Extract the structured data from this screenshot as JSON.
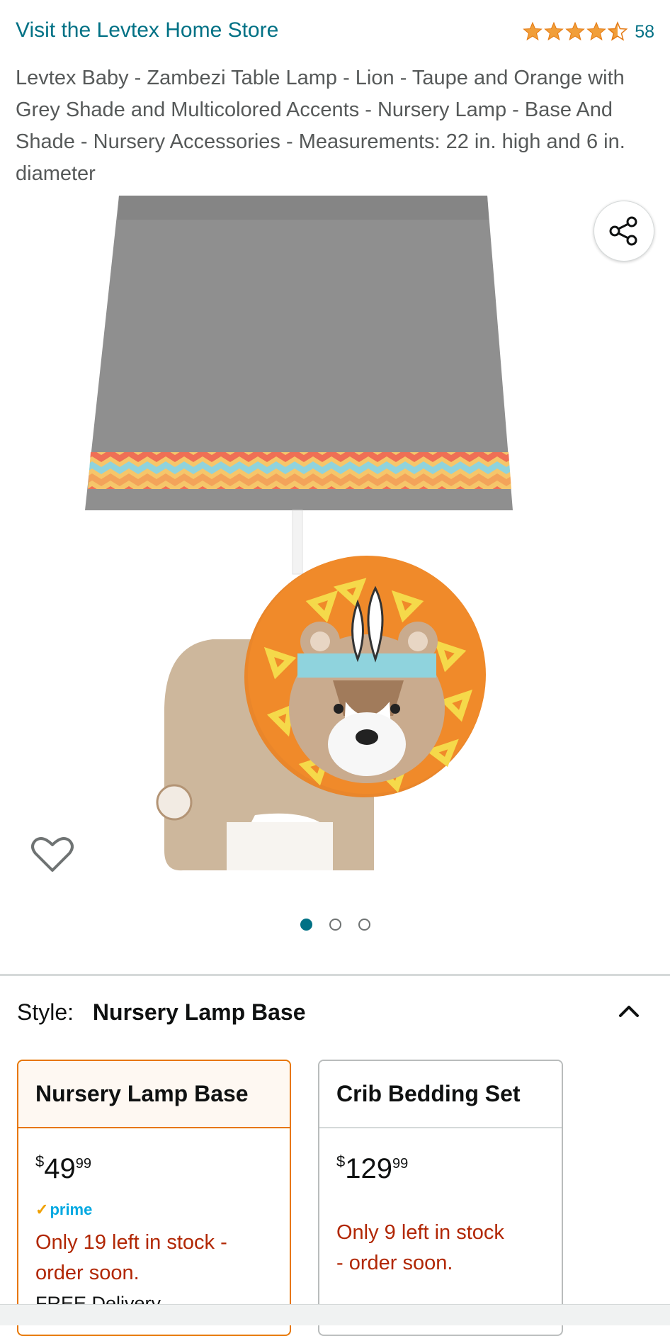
{
  "store": {
    "link_text": "Visit the Levtex Home Store"
  },
  "rating": {
    "stars": 4.5,
    "count": "58",
    "color": "#f19e39"
  },
  "product": {
    "title": "Levtex Baby - Zambezi Table Lamp - Lion - Taupe and Orange with Grey Shade and Multicolored Accents - Nursery Lamp - Base And Shade - Nursery Accessories - Measurements: 22 in. high and 6 in. diameter"
  },
  "gallery": {
    "image_count": 3,
    "active_index": 0
  },
  "style_selector": {
    "label": "Style:",
    "selected": "Nursery Lamp Base"
  },
  "options": [
    {
      "name": "Nursery Lamp Base",
      "currency": "$",
      "price_whole": "49",
      "price_fraction": "99",
      "prime": "prime",
      "stock_line1": "Only 19 left in stock -",
      "stock_line2": "order soon.",
      "delivery": "FREE Delivery"
    },
    {
      "name": "Crib Bedding Set",
      "currency": "$",
      "price_whole": "129",
      "price_fraction": "99",
      "stock_line1": "Only 9 left in stock",
      "stock_line2": "- order soon."
    }
  ],
  "colors": {
    "link": "#007185",
    "accent_selected": "#e77600",
    "stock_warning": "#b12704",
    "prime": "#00a8e1"
  }
}
